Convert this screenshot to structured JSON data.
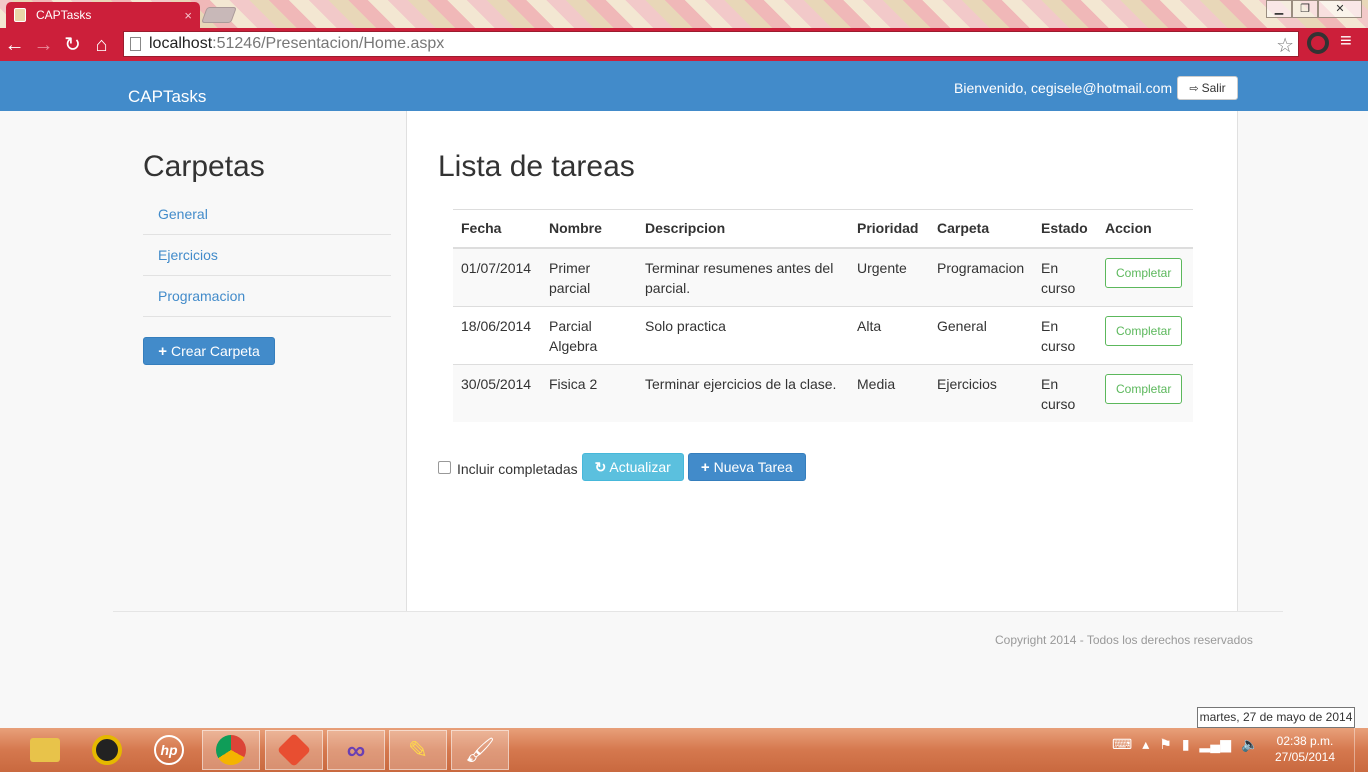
{
  "browser": {
    "tab_title": "CAPTasks",
    "tab_close": "×",
    "url_host": "localhost",
    "url_path": ":51246/Presentacion/Home.aspx"
  },
  "navbar": {
    "brand": "CAPTasks",
    "welcome": "Bienvenido, cegisele@hotmail.com",
    "logout_label": "Salir"
  },
  "sidebar": {
    "title": "Carpetas",
    "folders": [
      {
        "label": "General"
      },
      {
        "label": "Ejercicios"
      },
      {
        "label": "Programacion"
      }
    ],
    "create_label": "Crear Carpeta"
  },
  "main": {
    "title": "Lista de tareas",
    "columns": [
      "Fecha",
      "Nombre",
      "Descripcion",
      "Prioridad",
      "Carpeta",
      "Estado",
      "Accion"
    ],
    "rows": [
      {
        "fecha": "01/07/2014",
        "nombre": "Primer parcial",
        "descripcion": "Terminar resumenes antes del parcial.",
        "prioridad": "Urgente",
        "carpeta": "Programacion",
        "estado": "En curso",
        "accion": "Completar"
      },
      {
        "fecha": "18/06/2014",
        "nombre": "Parcial Algebra",
        "descripcion": "Solo practica",
        "prioridad": "Alta",
        "carpeta": "General",
        "estado": "En curso",
        "accion": "Completar"
      },
      {
        "fecha": "30/05/2014",
        "nombre": "Fisica 2",
        "descripcion": "Terminar ejercicios de la clase.",
        "prioridad": "Media",
        "carpeta": "Ejercicios",
        "estado": "En curso",
        "accion": "Completar"
      }
    ],
    "include_completed_label": "Incluir completadas",
    "include_completed_checked": false,
    "refresh_label": "Actualizar",
    "new_task_label": "Nueva Tarea"
  },
  "footer": {
    "copyright": "Copyright 2014 - Todos los derechos reservados"
  },
  "taskbar": {
    "time": "02:38 p.m.",
    "date": "27/05/2014",
    "tooltip": "martes, 27 de mayo de 2014",
    "pinned": [
      "file-explorer-icon",
      "media-player-icon",
      "hp-icon",
      "chrome-icon",
      "git-icon",
      "visual-studio-icon",
      "tools-icon",
      "paint-icon"
    ]
  },
  "colors": {
    "primary": "#428bca",
    "info": "#5bc0de",
    "success": "#5cb85c",
    "browser_accent": "#cc1f3a"
  }
}
